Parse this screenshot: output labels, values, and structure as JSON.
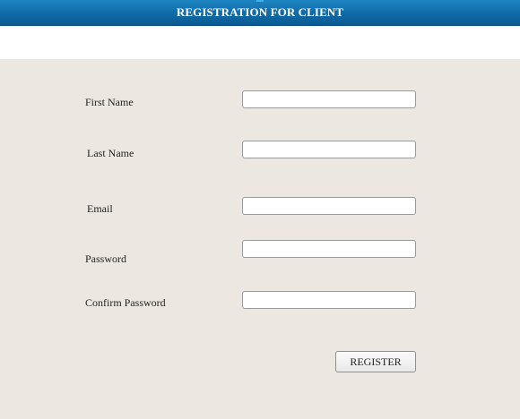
{
  "header": {
    "title": "REGISTRATION FOR CLIENT"
  },
  "form": {
    "fields": [
      {
        "label": "First Name",
        "value": ""
      },
      {
        "label": "Last Name",
        "value": ""
      },
      {
        "label": "Email",
        "value": ""
      },
      {
        "label": "Password",
        "value": ""
      },
      {
        "label": "Confirm Password",
        "value": ""
      }
    ],
    "submit_label": "REGISTER"
  },
  "colors": {
    "header_bg": "#0f6aa6",
    "header_text": "#ffffff",
    "panel_bg": "#ece8e1"
  }
}
